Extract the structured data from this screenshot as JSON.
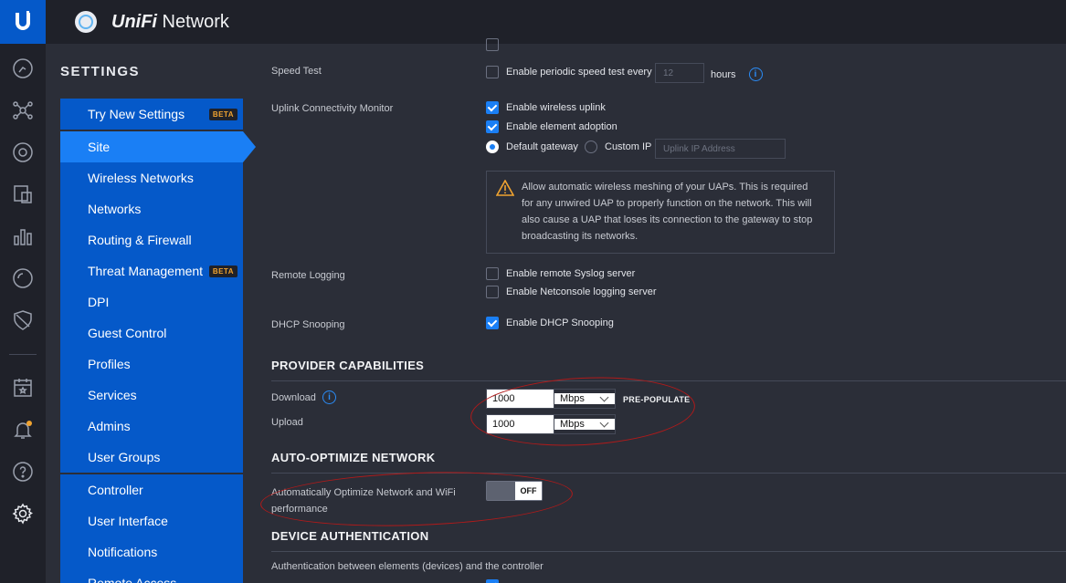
{
  "app": {
    "logo_letter": "U",
    "brand_bold": "UniFi",
    "brand_rest": " Network"
  },
  "rail": {
    "icons": [
      "dashboard-icon",
      "topology-icon",
      "devices-icon",
      "clients-icon",
      "statistics-icon",
      "insights-icon",
      "threat-icon",
      "events-icon",
      "alerts-icon",
      "help-icon",
      "settings-icon"
    ]
  },
  "sidebar": {
    "title": "SETTINGS",
    "items": [
      {
        "label": "Try New Settings",
        "badge": "BETA"
      },
      {
        "label": "Site"
      },
      {
        "label": "Wireless Networks"
      },
      {
        "label": "Networks"
      },
      {
        "label": "Routing & Firewall"
      },
      {
        "label": "Threat Management",
        "badge": "BETA"
      },
      {
        "label": "DPI"
      },
      {
        "label": "Guest Control"
      },
      {
        "label": "Profiles"
      },
      {
        "label": "Services"
      },
      {
        "label": "Admins"
      },
      {
        "label": "User Groups"
      },
      {
        "label": "Controller"
      },
      {
        "label": "User Interface"
      },
      {
        "label": "Notifications"
      },
      {
        "label": "Remote Access"
      }
    ],
    "active": "Site"
  },
  "speed_test": {
    "label": "Speed Test",
    "checkbox_label": "Enable periodic speed test every",
    "checked": false,
    "interval_placeholder": "12",
    "unit": "hours"
  },
  "uplink": {
    "label": "Uplink Connectivity Monitor",
    "wireless_uplink": "Enable wireless uplink",
    "element_adoption": "Enable element adoption",
    "default_gateway": "Default gateway",
    "custom_ip": "Custom IP",
    "uplink_ip_placeholder": "Uplink IP Address",
    "warning": "Allow automatic wireless meshing of your UAPs. This is required for any unwired UAP to properly function on the network. This will also cause a UAP that loses its connection to the gateway to stop broadcasting its networks."
  },
  "remote_logging": {
    "label": "Remote Logging",
    "syslog": "Enable remote Syslog server",
    "netconsole": "Enable Netconsole logging server"
  },
  "dhcp": {
    "label": "DHCP Snooping",
    "checkbox_label": "Enable DHCP Snooping"
  },
  "provider": {
    "title": "PROVIDER CAPABILITIES",
    "download_label": "Download",
    "upload_label": "Upload",
    "download_value": "1000",
    "upload_value": "1000",
    "unit": "Mbps",
    "prepopulate": "PRE-POPULATE"
  },
  "auto_optimize": {
    "title": "AUTO-OPTIMIZE NETWORK",
    "label_line1": "Automatically Optimize Network and WiFi",
    "label_line2": "performance",
    "toggle": "OFF"
  },
  "device_auth": {
    "title": "DEVICE AUTHENTICATION",
    "description": "Authentication between elements (devices) and the controller"
  },
  "colors": {
    "accent": "#0559c9",
    "active": "#1a7ff5",
    "annotation": "#b01a1a"
  }
}
